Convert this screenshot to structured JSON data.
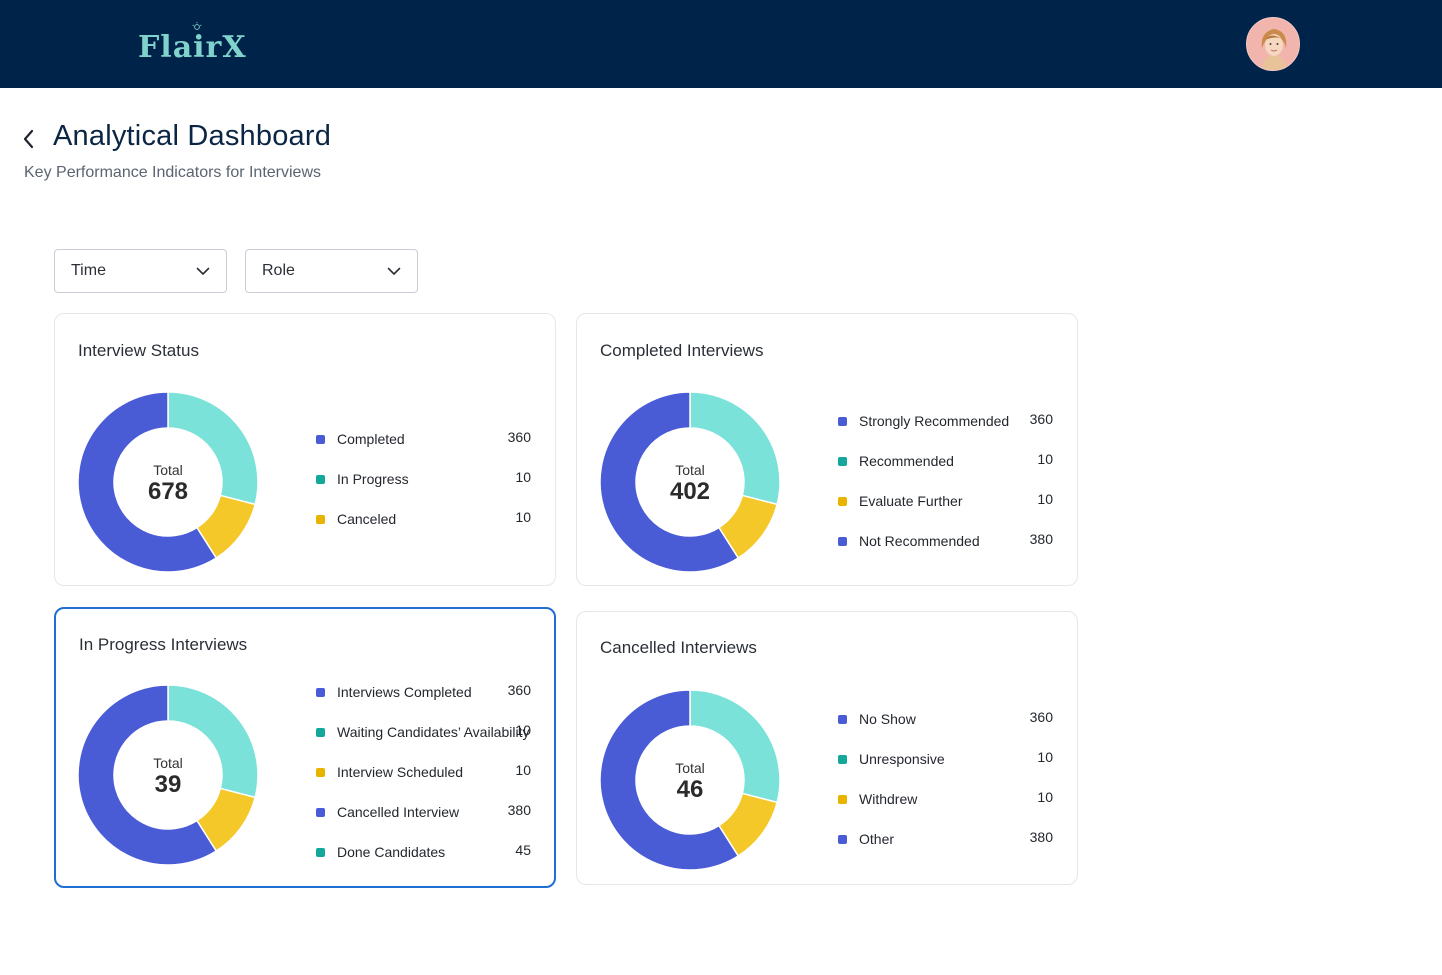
{
  "header": {
    "logo_text": "FlairX",
    "avatar_icon": "user-avatar"
  },
  "page": {
    "title": "Analytical Dashboard",
    "subtitle": "Key Performance Indicators for Interviews",
    "back_icon": "chevron-left-icon"
  },
  "filters": {
    "time_label": "Time",
    "role_label": "Role"
  },
  "colors": {
    "navy": "#00234a",
    "blue": "#4a5bd6",
    "teal": "#7ae2d8",
    "yellow": "#f5c82a",
    "dot_teal": "#14a89a",
    "dot_yellow": "#e9b400",
    "selected_border": "#1f6fd1"
  },
  "cards": [
    {
      "title": "Interview Status",
      "total_label": "Total",
      "total_value": "678",
      "segments": [
        0.29,
        0.12,
        0.59
      ],
      "legend": [
        {
          "label": "Completed",
          "value": "360",
          "color": "#4a5bd6"
        },
        {
          "label": "In Progress",
          "value": "10",
          "color": "#14a89a"
        },
        {
          "label": "Canceled",
          "value": "10",
          "color": "#e9b400"
        }
      ]
    },
    {
      "title": "Completed Interviews",
      "total_label": "Total",
      "total_value": "402",
      "segments": [
        0.29,
        0.12,
        0.59
      ],
      "legend": [
        {
          "label": "Strongly Recommended",
          "value": "360",
          "color": "#4a5bd6"
        },
        {
          "label": "Recommended",
          "value": "10",
          "color": "#14a89a"
        },
        {
          "label": "Evaluate Further",
          "value": "10",
          "color": "#e9b400"
        },
        {
          "label": "Not Recommended",
          "value": "380",
          "color": "#4a5bd6"
        }
      ]
    },
    {
      "title": "In Progress Interviews",
      "total_label": "Total",
      "total_value": "39",
      "segments": [
        0.29,
        0.12,
        0.59
      ],
      "legend": [
        {
          "label": "Interviews Completed",
          "value": "360",
          "color": "#4a5bd6"
        },
        {
          "label": "Waiting Candidates’ Availability",
          "value": "10",
          "color": "#14a89a"
        },
        {
          "label": "Interview Scheduled",
          "value": "10",
          "color": "#e9b400"
        },
        {
          "label": "Cancelled Interview",
          "value": "380",
          "color": "#4a5bd6"
        },
        {
          "label": "Done Candidates",
          "value": "45",
          "color": "#14a89a"
        }
      ]
    },
    {
      "title": "Cancelled Interviews",
      "total_label": "Total",
      "total_value": "46",
      "segments": [
        0.29,
        0.12,
        0.59
      ],
      "legend": [
        {
          "label": "No Show",
          "value": "360",
          "color": "#4a5bd6"
        },
        {
          "label": "Unresponsive",
          "value": "10",
          "color": "#14a89a"
        },
        {
          "label": "Withdrew",
          "value": "10",
          "color": "#e9b400"
        },
        {
          "label": "Other",
          "value": "380",
          "color": "#4a5bd6"
        }
      ]
    }
  ]
}
